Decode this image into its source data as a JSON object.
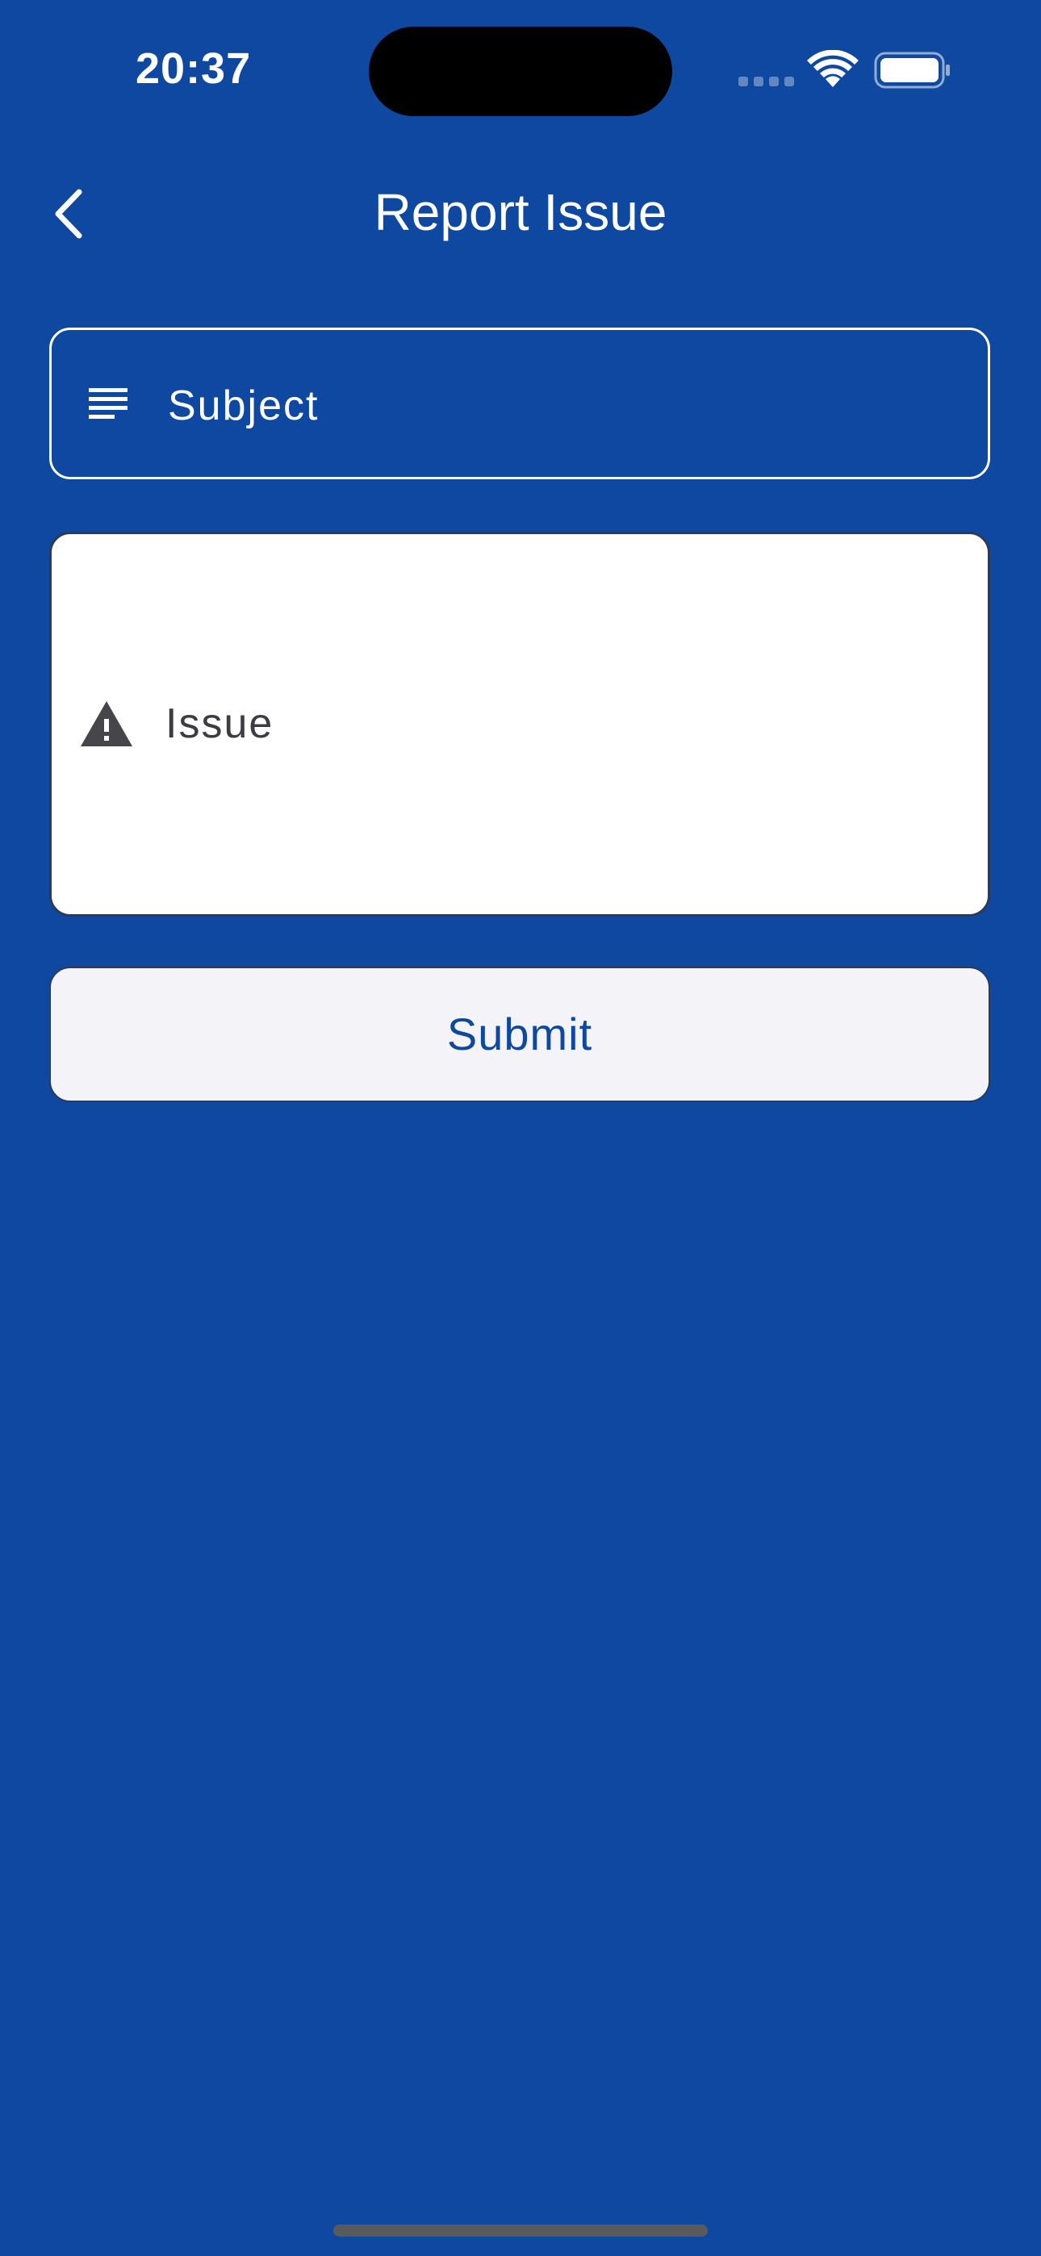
{
  "status_bar": {
    "time": "20:37"
  },
  "nav": {
    "title": "Report Issue",
    "back_icon": "chevron-left-icon"
  },
  "form": {
    "subject": {
      "placeholder": "Subject",
      "icon": "notes-lines-icon"
    },
    "issue": {
      "placeholder": "Issue",
      "icon": "warning-triangle-icon"
    },
    "submit_label": "Submit"
  },
  "colors": {
    "background": "#0f48a0",
    "accent_text": "#0f48a0",
    "button_background": "#f3f3f8"
  }
}
